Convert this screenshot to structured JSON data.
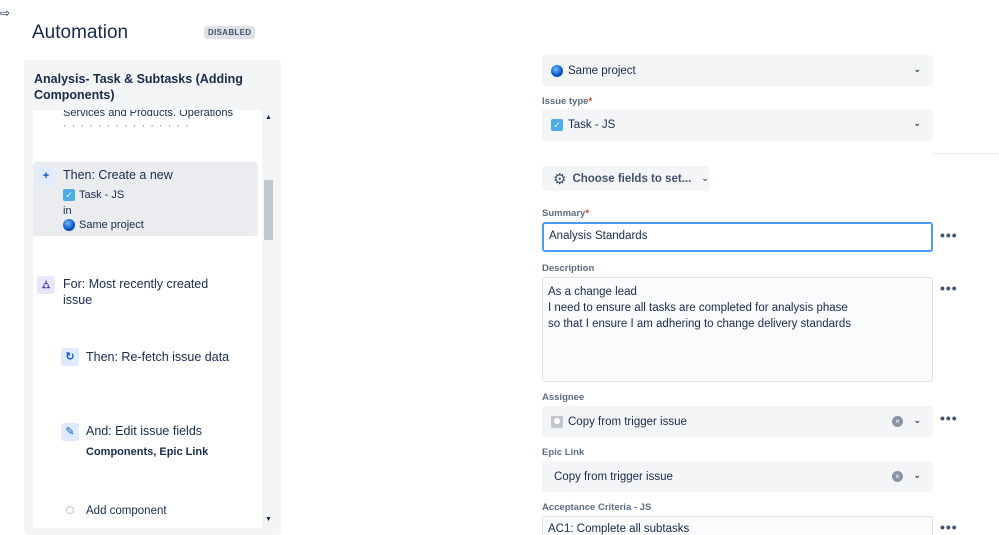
{
  "header": {
    "corner_symbol": "⇨",
    "title": "Automation",
    "status_badge": "DISABLED"
  },
  "rule": {
    "name": "Analysis-  Task & Subtasks (Adding Components)",
    "prev_text": "Services and Products. Operations",
    "steps": [
      {
        "icon": "+",
        "title": "Then: Create a new",
        "issue_type": "Task - JS",
        "in_label": "in",
        "project": "Same project"
      },
      {
        "icon": "branch",
        "title": "For: Most recently created issue"
      },
      {
        "icon": "refresh",
        "title": "Then: Re-fetch issue data"
      },
      {
        "icon": "pencil",
        "title": "And: Edit issue fields",
        "fields_a": "Components",
        "fields_sep": ",",
        "fields_b": "Epic Link"
      }
    ],
    "add_component_label": "Add component"
  },
  "form": {
    "project_value": "Same project",
    "issue_type_label": "Issue type",
    "issue_type_value": "Task - JS",
    "choose_fields_label": "Choose fields to set...",
    "summary_label": "Summary",
    "summary_value": "Analysis Standards",
    "description_label": "Description",
    "description_lines": [
      "As a change lead",
      "I need to ensure all tasks are completed for analysis phase",
      "so that I ensure I am adhering to change delivery standards"
    ],
    "assignee_label": "Assignee",
    "assignee_value": "Copy from trigger issue",
    "epic_link_label": "Epic Link",
    "epic_link_value": "Copy from trigger issue",
    "acceptance_label": "Acceptance Criteria - JS",
    "acceptance_value": "AC1:  Complete all subtasks",
    "required_mark": "*",
    "more_label": "•••"
  }
}
